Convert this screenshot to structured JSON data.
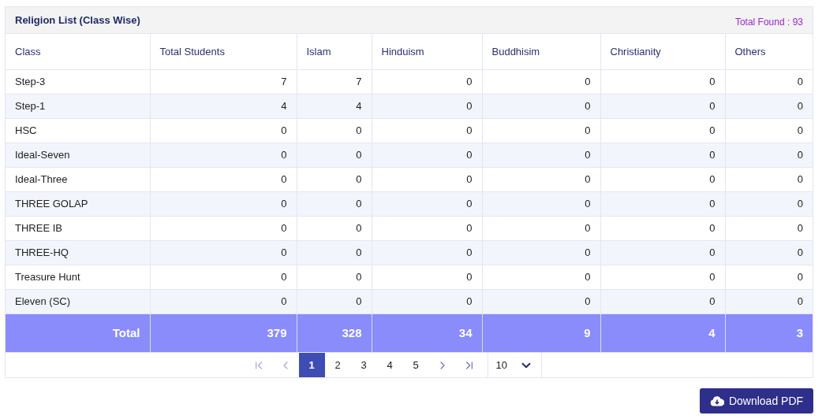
{
  "panel": {
    "title": "Religion List (Class Wise)",
    "total_found": "Total Found : 93"
  },
  "table": {
    "columns": [
      "Class",
      "Total Students",
      "Islam",
      "Hinduism",
      "Buddhisim",
      "Christianity",
      "Others"
    ],
    "rows": [
      [
        "Step-3",
        "7",
        "7",
        "0",
        "0",
        "0",
        "0"
      ],
      [
        "Step-1",
        "4",
        "4",
        "0",
        "0",
        "0",
        "0"
      ],
      [
        "HSC",
        "0",
        "0",
        "0",
        "0",
        "0",
        "0"
      ],
      [
        "Ideal-Seven",
        "0",
        "0",
        "0",
        "0",
        "0",
        "0"
      ],
      [
        "Ideal-Three",
        "0",
        "0",
        "0",
        "0",
        "0",
        "0"
      ],
      [
        "THREE GOLAP",
        "0",
        "0",
        "0",
        "0",
        "0",
        "0"
      ],
      [
        "THREE IB",
        "0",
        "0",
        "0",
        "0",
        "0",
        "0"
      ],
      [
        "THREE-HQ",
        "0",
        "0",
        "0",
        "0",
        "0",
        "0"
      ],
      [
        "Treasure Hunt",
        "0",
        "0",
        "0",
        "0",
        "0",
        "0"
      ],
      [
        "Eleven (SC)",
        "0",
        "0",
        "0",
        "0",
        "0",
        "0"
      ]
    ],
    "total_row": [
      "Total",
      "379",
      "328",
      "34",
      "9",
      "4",
      "3"
    ]
  },
  "pagination": {
    "nav": [
      {
        "kind": "first",
        "disabled": true
      },
      {
        "kind": "prev",
        "disabled": true
      }
    ],
    "pages": [
      {
        "label": "1",
        "selected": true
      },
      {
        "label": "2",
        "selected": false
      },
      {
        "label": "3",
        "selected": false
      },
      {
        "label": "4",
        "selected": false
      },
      {
        "label": "5",
        "selected": false
      }
    ],
    "nav_after": [
      {
        "kind": "next",
        "disabled": false
      },
      {
        "kind": "last",
        "disabled": false
      }
    ],
    "page_size": "10"
  },
  "download_button": "Download PDF"
}
